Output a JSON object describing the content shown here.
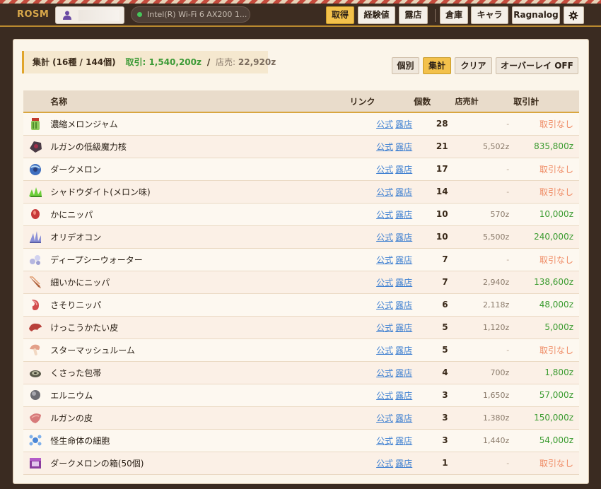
{
  "app": {
    "brand": "ROSM",
    "network": "Intel(R) Wi-Fi 6 AX200 1...",
    "nav": {
      "acquire": "取得",
      "exp": "経験値",
      "shop": "露店",
      "warehouse": "倉庫",
      "chara": "キャラ",
      "ragnalog": "Ragnalog"
    }
  },
  "summary": {
    "title": "集計 (16種 / 144個)",
    "trade_label": "取引: 1,540,200z",
    "slash": "/",
    "shop_label": "店売:",
    "shop_value": "22,920z"
  },
  "mode_buttons": {
    "individual": "個別",
    "aggregate": "集計",
    "clear": "クリア",
    "overlay": "オーバーレイ OFF"
  },
  "table": {
    "headers": {
      "name": "名称",
      "link": "リンク",
      "count": "個数",
      "shop_total": "店売計",
      "trade_total": "取引計"
    },
    "link_official": "公式",
    "link_shop": "露店",
    "rows": [
      {
        "icon": "melon-jam-jar-icon",
        "name": "濃縮メロンジャム",
        "count": "28",
        "shop": "-",
        "trade": "取引なし",
        "trade_has": false
      },
      {
        "icon": "magic-core-icon",
        "name": "ルガンの低級魔力核",
        "count": "21",
        "shop": "5,502z",
        "trade": "835,800z",
        "trade_has": true
      },
      {
        "icon": "dark-melon-icon",
        "name": "ダークメロン",
        "count": "17",
        "shop": "-",
        "trade": "取引なし",
        "trade_has": false
      },
      {
        "icon": "shadowdite-icon",
        "name": "シャドウダイト(メロン味)",
        "count": "14",
        "shop": "-",
        "trade": "取引なし",
        "trade_has": false
      },
      {
        "icon": "crab-nipper-icon",
        "name": "かにニッパ",
        "count": "10",
        "shop": "570z",
        "trade": "10,000z",
        "trade_has": true
      },
      {
        "icon": "oridecon-icon",
        "name": "オリデオコン",
        "count": "10",
        "shop": "5,500z",
        "trade": "240,000z",
        "trade_has": true
      },
      {
        "icon": "deep-sea-water-icon",
        "name": "ディープシーウォーター",
        "count": "7",
        "shop": "-",
        "trade": "取引なし",
        "trade_has": false
      },
      {
        "icon": "thin-crab-nipper-icon",
        "name": "細いかにニッパ",
        "count": "7",
        "shop": "2,940z",
        "trade": "138,600z",
        "trade_has": true
      },
      {
        "icon": "scorpion-nipper-icon",
        "name": "さそりニッパ",
        "count": "6",
        "shop": "2,118z",
        "trade": "48,000z",
        "trade_has": true
      },
      {
        "icon": "hard-skin-icon",
        "name": "けっこうかたい皮",
        "count": "5",
        "shop": "1,120z",
        "trade": "5,000z",
        "trade_has": true
      },
      {
        "icon": "star-mushroom-icon",
        "name": "スターマッシュルーム",
        "count": "5",
        "shop": "-",
        "trade": "取引なし",
        "trade_has": false
      },
      {
        "icon": "rotten-bandage-icon",
        "name": "くさった包帯",
        "count": "4",
        "shop": "700z",
        "trade": "1,800z",
        "trade_has": true
      },
      {
        "icon": "elunium-icon",
        "name": "エルニウム",
        "count": "3",
        "shop": "1,650z",
        "trade": "57,000z",
        "trade_has": true
      },
      {
        "icon": "rugan-skin-icon",
        "name": "ルガンの皮",
        "count": "3",
        "shop": "1,380z",
        "trade": "150,000z",
        "trade_has": true
      },
      {
        "icon": "monster-cell-icon",
        "name": "怪生命体の細胞",
        "count": "3",
        "shop": "1,440z",
        "trade": "54,000z",
        "trade_has": true
      },
      {
        "icon": "dark-melon-box-icon",
        "name": "ダークメロンの箱(50個)",
        "count": "1",
        "shop": "-",
        "trade": "取引なし",
        "trade_has": false
      }
    ]
  }
}
